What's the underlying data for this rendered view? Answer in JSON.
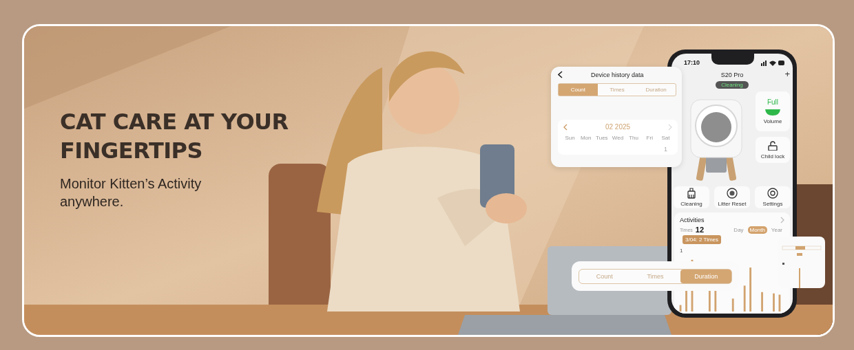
{
  "headline": "CAT CARE AT YOUR FINGERTIPS",
  "subtitle": "Monitor Kitten’s Activity anywhere.",
  "history_card": {
    "title": "Device history data",
    "tabs": [
      {
        "label": "Count",
        "selected": true
      },
      {
        "label": "Times",
        "selected": false
      },
      {
        "label": "Duration",
        "selected": false
      }
    ],
    "month": "02 2025",
    "weekdays": [
      "Sun",
      "Mon",
      "Tues",
      "Wed",
      "Thu",
      "Fri",
      "Sat"
    ],
    "dates": [
      "1"
    ]
  },
  "phone": {
    "time": "17:10",
    "title": "S20 Pro",
    "add": "+",
    "status": "Cleaning",
    "volume": {
      "value": "Full",
      "label": "Volume"
    },
    "lock": {
      "label": "Child lock"
    },
    "actions": [
      {
        "kind": "broom",
        "label": "Cleaning"
      },
      {
        "kind": "reset",
        "label": "Litter Reset"
      },
      {
        "kind": "gear",
        "label": "Settings"
      }
    ],
    "activities": {
      "title": "Activities",
      "times_label": "Times",
      "times_value": "12",
      "periods": [
        {
          "label": "Day",
          "selected": false
        },
        {
          "label": "Month",
          "selected": true
        },
        {
          "label": "Year",
          "selected": false
        }
      ],
      "tooltip": "3/04: 2 Times",
      "axis_label": "1"
    }
  },
  "segment_control": [
    {
      "label": "Count",
      "selected": false
    },
    {
      "label": "Times",
      "selected": false
    },
    {
      "label": "Duration",
      "selected": true
    }
  ]
}
